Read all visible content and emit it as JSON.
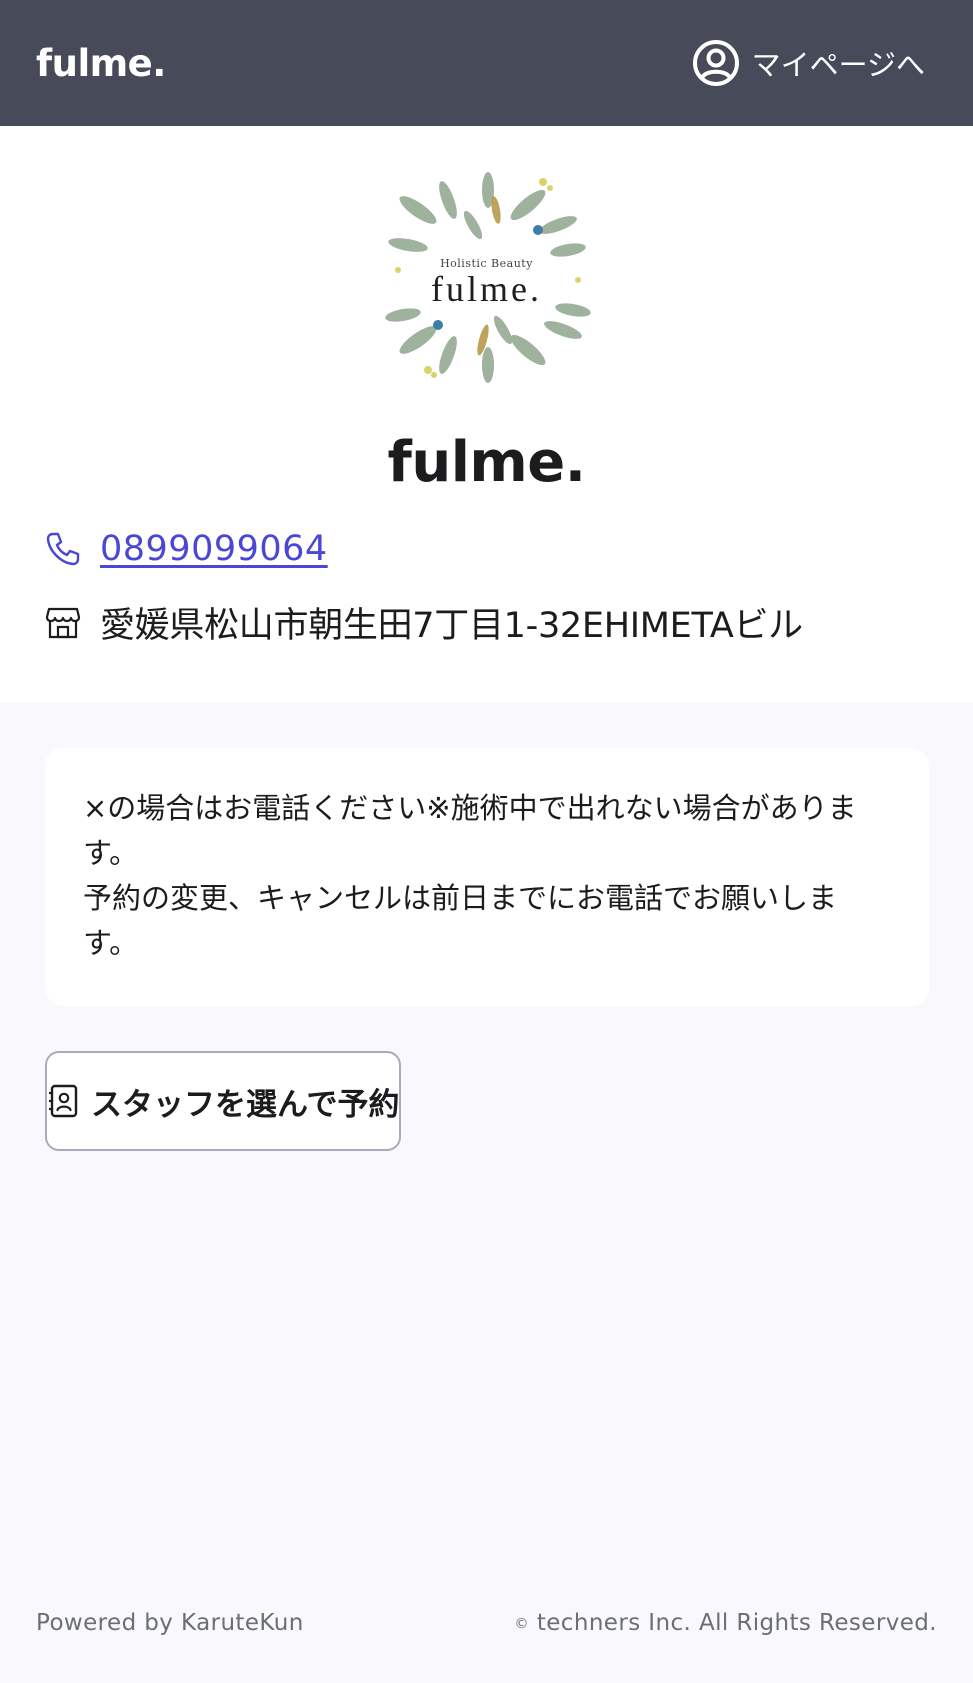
{
  "header": {
    "brand": "fulme.",
    "mypage_label": "マイページへ"
  },
  "shop": {
    "logo_subtitle": "Holistic Beauty",
    "logo_title": "fulme.",
    "name": "fulme.",
    "phone": "0899099064",
    "address": "愛媛県松山市朝生田7丁目1-32EHIMETAビル"
  },
  "notice": {
    "text": "×の場合はお電話ください※施術中で出れない場合があります。\n予約の変更、キャンセルは前日までにお電話でお願いします。"
  },
  "reserve": {
    "button_label": "スタッフを選んで予約"
  },
  "footer": {
    "powered_by": "Powered by KaruteKun",
    "copyright_mark": "©",
    "copyright": "techners Inc. All Rights Reserved."
  },
  "icons": {
    "account": "user-circle-icon",
    "phone": "phone-icon",
    "shop": "store-icon",
    "staff": "contact-card-icon"
  },
  "colors": {
    "header_bg": "#474b59",
    "link": "#4b47d6",
    "page_bg": "#f8f8fd"
  }
}
